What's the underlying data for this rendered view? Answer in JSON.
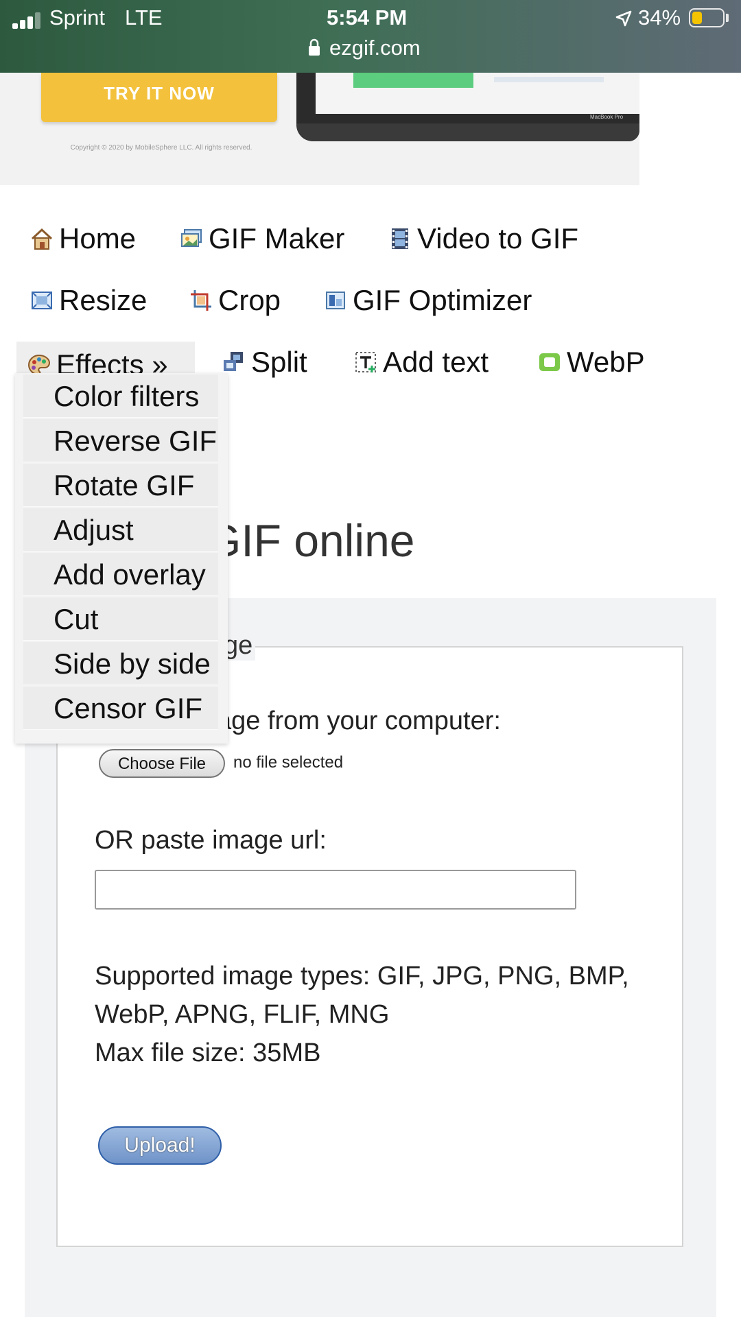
{
  "status_bar": {
    "carrier": "Sprint",
    "network": "LTE",
    "time": "5:54 PM",
    "battery": "34%",
    "url": "ezgif.com",
    "signal_bars_filled": 3,
    "battery_level": 0.34,
    "battery_color": "#f5c400",
    "background": "#3a6a4e"
  },
  "banner": {
    "try_button": "TRY IT NOW",
    "copyright": "Copyright © 2020 by MobileSphere LLC. All rights reserved.",
    "laptop_label": "MacBook Pro"
  },
  "nav": {
    "home": "Home",
    "gif_maker": "GIF Maker",
    "video_to_gif": "Video to GIF",
    "resize": "Resize",
    "crop": "Crop",
    "gif_optimizer": "GIF Optimizer",
    "effects": "Effects »",
    "split": "Split",
    "add_text": "Add text",
    "webp": "WebP"
  },
  "effects_menu": {
    "items": [
      "Color filters",
      "Reverse GIF",
      "Rotate GIF",
      "Adjust",
      "Add overlay",
      "Cut",
      "Side by side",
      "Censor GIF"
    ]
  },
  "main": {
    "heading_visible": "GIF online",
    "legend_visible": "ge",
    "upload_label_visible": "age from your computer:",
    "choose_file": "Choose File",
    "no_file": "no file selected",
    "url_label": "OR paste image url:",
    "url_value": "",
    "supported_line1": "Supported image types: GIF, JPG, PNG, BMP,",
    "supported_line2": "WebP, APNG, FLIF, MNG",
    "max_size": "Max file size: 35MB",
    "upload_button": "Upload!"
  },
  "icons": {
    "home": "house-icon",
    "gif_maker": "image-stack-icon",
    "video_to_gif": "film-icon",
    "resize": "resize-icon",
    "crop": "crop-icon",
    "gif_optimizer": "optimizer-icon",
    "effects": "palette-icon",
    "split": "split-icon",
    "add_text": "text-tool-icon",
    "webp": "webp-icon"
  },
  "colors": {
    "accent_yellow": "#f3c13c",
    "upload_blue": "#6f93c9",
    "panel_gray": "#f2f3f5"
  }
}
